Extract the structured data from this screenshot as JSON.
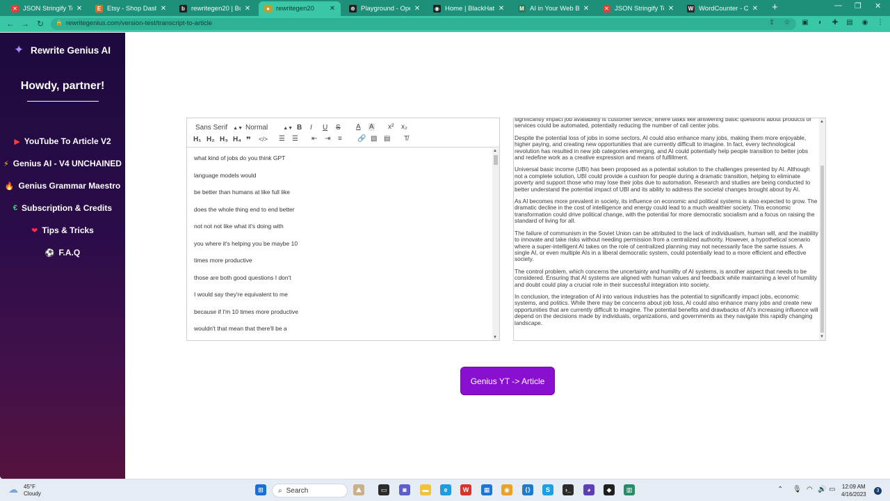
{
  "browser": {
    "tabs": [
      {
        "title": "JSON Stringify Text - C",
        "icon": "wrench-icon",
        "color": "#e0403a",
        "glyph": "✕"
      },
      {
        "title": "Etsy - Shop Dashboard",
        "icon": "etsy-icon",
        "color": "#f1641e",
        "glyph": "E"
      },
      {
        "title": "rewritegen20 | Bubble",
        "icon": "bubble-icon",
        "color": "#222222",
        "glyph": "b"
      },
      {
        "title": "rewritegen20",
        "icon": "site-icon",
        "color": "#c79a2a",
        "glyph": "●",
        "active": true
      },
      {
        "title": "Playground - OpenAI",
        "icon": "openai-icon",
        "color": "#202020",
        "glyph": "⊛"
      },
      {
        "title": "Home | BlackHatWorld",
        "icon": "bhw-icon",
        "color": "#202020",
        "glyph": "◉"
      },
      {
        "title": "AI in Your Web Browser",
        "icon": "extension-icon",
        "color": "#2a7a55",
        "glyph": "M"
      },
      {
        "title": "JSON Stringify Text - C",
        "icon": "wrench-icon",
        "color": "#e0403a",
        "glyph": "✕"
      },
      {
        "title": "WordCounter - Count",
        "icon": "wordcounter-icon",
        "color": "#2b2b2b",
        "glyph": "W"
      }
    ],
    "url": "rewritegenius.com/version-test/transcript-to-article"
  },
  "sidebar": {
    "brand": "Rewrite Genius AI",
    "greeting": "Howdy, partner!",
    "items": [
      {
        "label": "YouTube To Article V2",
        "icon": "youtube-icon",
        "glyph": "▶",
        "color": "#ff3b3b"
      },
      {
        "label": "Genius AI - V4 UNCHAINED",
        "icon": "lightning-icon",
        "glyph": "⚡",
        "color": "#ffd21f"
      },
      {
        "label": "Genius Grammar Maestro",
        "icon": "flame-icon",
        "glyph": "🔥",
        "color": "#ff7a2a"
      },
      {
        "label": "Subscription & Credits",
        "icon": "euro-icon",
        "glyph": "€",
        "color": "#3fd16b"
      },
      {
        "label": "Tips & Tricks",
        "icon": "heart-icon",
        "glyph": "❤",
        "color": "#ff2d4a"
      },
      {
        "label": "F.A.Q",
        "icon": "soccer-ball-icon",
        "glyph": "⚽",
        "color": "#ffffff"
      }
    ]
  },
  "editor": {
    "font_select": "Sans Serif",
    "size_select": "Normal",
    "lines": [
      "what kind of jobs do you think GPT",
      "language models would",
      "be better than humans at like full like",
      "does the whole thing end to end better",
      "not not not like what it's doing with",
      "you where it's helping you be maybe 10",
      "times more productive",
      "those are both good questions I don't",
      "I would say they're equivalent to me",
      "because if I'm 10 times more productive",
      "wouldn't that mean that there'll be a"
    ]
  },
  "output": {
    "paragraphs": [
      "significantly impact job availability is customer service, where tasks like answering basic questions about products or services could be automated, potentially reducing the number of call center jobs.",
      "Despite the potential loss of jobs in some sectors, AI could also enhance many jobs, making them more enjoyable, higher paying, and creating new opportunities that are currently difficult to imagine. In fact, every technological revolution has resulted in new job categories emerging, and AI could potentially help people transition to better jobs and redefine work as a creative expression and means of fulfillment.",
      "Universal basic income (UBI) has been proposed as a potential solution to the challenges presented by AI. Although not a complete solution, UBI could provide a cushion for people during a dramatic transition, helping to eliminate poverty and support those who may lose their jobs due to automation. Research and studies are being conducted to better understand the potential impact of UBI and its ability to address the societal changes brought about by AI.",
      "As AI becomes more prevalent in society, its influence on economic and political systems is also expected to grow. The dramatic decline in the cost of intelligence and energy could lead to a much wealthier society. This economic transformation could drive political change, with the potential for more democratic socialism and a focus on raising the standard of living for all.",
      "The failure of communism in the Soviet Union can be attributed to the lack of individualism, human will, and the inability to innovate and take risks without needing permission from a centralized authority. However, a hypothetical scenario where a super-intelligent AI takes on the role of centralized planning may not necessarily face the same issues. A single AI, or even multiple AIs in a liberal democratic system, could potentially lead to a more efficient and effective society.",
      "The control problem, which concerns the uncertainty and humility of AI systems, is another aspect that needs to be considered. Ensuring that AI systems are aligned with human values and feedback while maintaining a level of humility and doubt could play a crucial role in their successful integration into society.",
      "In conclusion, the integration of AI into various industries has the potential to significantly impact jobs, economic systems, and politics. While there may be concerns about job loss, AI could also enhance many jobs and create new opportunities that are currently difficult to imagine. The potential benefits and drawbacks of AI's increasing influence will depend on the decisions made by individuals, organizations, and governments as they navigate this rapidly changing landscape."
    ]
  },
  "cta": {
    "label": "Genius YT -> Article"
  },
  "taskbar": {
    "temperature": "45°F",
    "condition": "Cloudy",
    "search_label": "Search",
    "time": "12:09 AM",
    "date": "4/16/2023",
    "notifications": "3"
  },
  "colors": {
    "sidebar_top": "#1d0a3e",
    "sidebar_bottom": "#55123f",
    "cta": "#8a10d0",
    "chrome": "#39c7a8"
  }
}
